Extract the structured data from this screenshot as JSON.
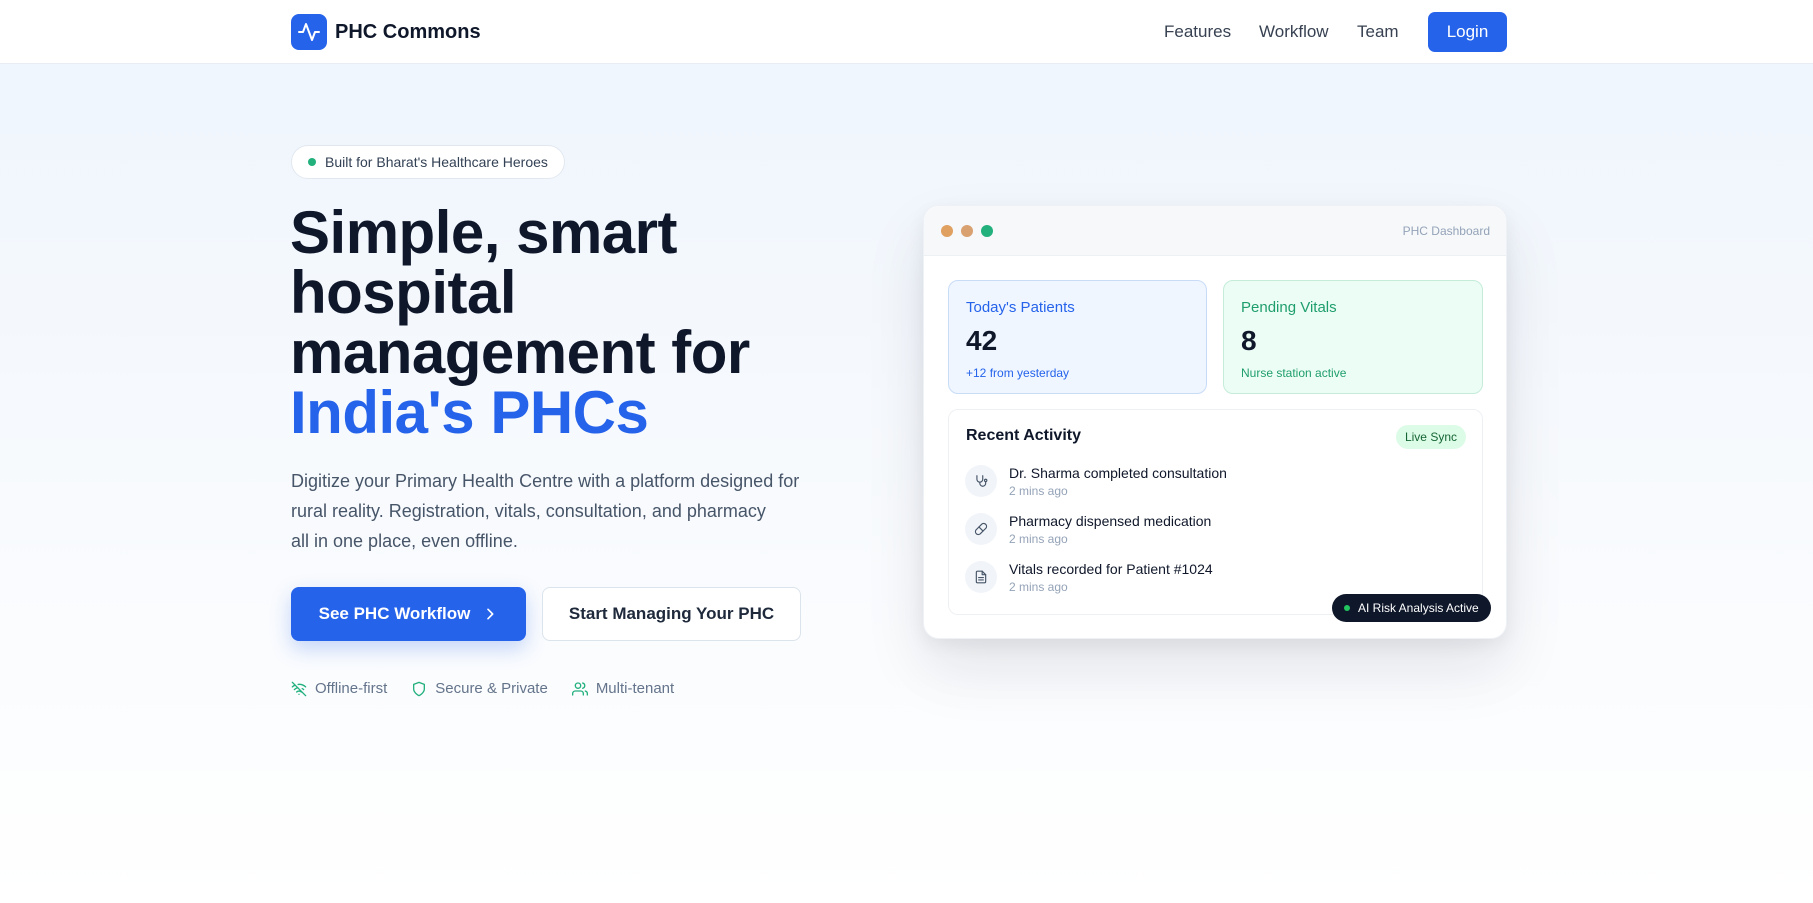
{
  "header": {
    "brand_name": "PHC Commons",
    "logo_icon": "activity-pulse-icon",
    "nav": [
      {
        "label": "Features"
      },
      {
        "label": "Workflow"
      },
      {
        "label": "Team"
      }
    ],
    "login_label": "Login"
  },
  "hero": {
    "badge": "Built for Bharat's Healthcare Heroes",
    "headline_lines": [
      "Simple, smart",
      "hospital",
      "management for"
    ],
    "headline_accent": "India's PHCs",
    "subtitle_lines": [
      "Digitize your Primary Health Centre with a platform designed for",
      "rural reality. Registration, vitals, consultation, and pharmacy",
      "all in one place, even offline."
    ],
    "primary_cta": "See PHC Workflow",
    "secondary_cta": "Start Managing Your PHC",
    "features": [
      {
        "label": "Offline-first",
        "icon": "wifi-off-icon"
      },
      {
        "label": "Secure & Private",
        "icon": "shield-icon"
      },
      {
        "label": "Multi-tenant",
        "icon": "users-icon"
      }
    ]
  },
  "dashboard": {
    "title": "PHC Dashboard",
    "stats": [
      {
        "label": "Today's Patients",
        "value": "42",
        "sub": "+12 from yesterday"
      },
      {
        "label": "Pending Vitals",
        "value": "8",
        "sub": "Nurse station active"
      }
    ],
    "activity": {
      "title": "Recent Activity",
      "badge": "Live Sync",
      "items": [
        {
          "text": "Dr. Sharma completed consultation",
          "time": "2 mins ago",
          "icon": "stethoscope-icon"
        },
        {
          "text": "Pharmacy dispensed medication",
          "time": "2 mins ago",
          "icon": "pill-icon"
        },
        {
          "text": "Vitals recorded for Patient #1024",
          "time": "2 mins ago",
          "icon": "file-text-icon"
        }
      ]
    },
    "ai_badge": "AI Risk Analysis Active"
  },
  "colors": {
    "primary": "#2563eb",
    "accent_green": "#22b07d",
    "text_dark": "#0f172a"
  }
}
